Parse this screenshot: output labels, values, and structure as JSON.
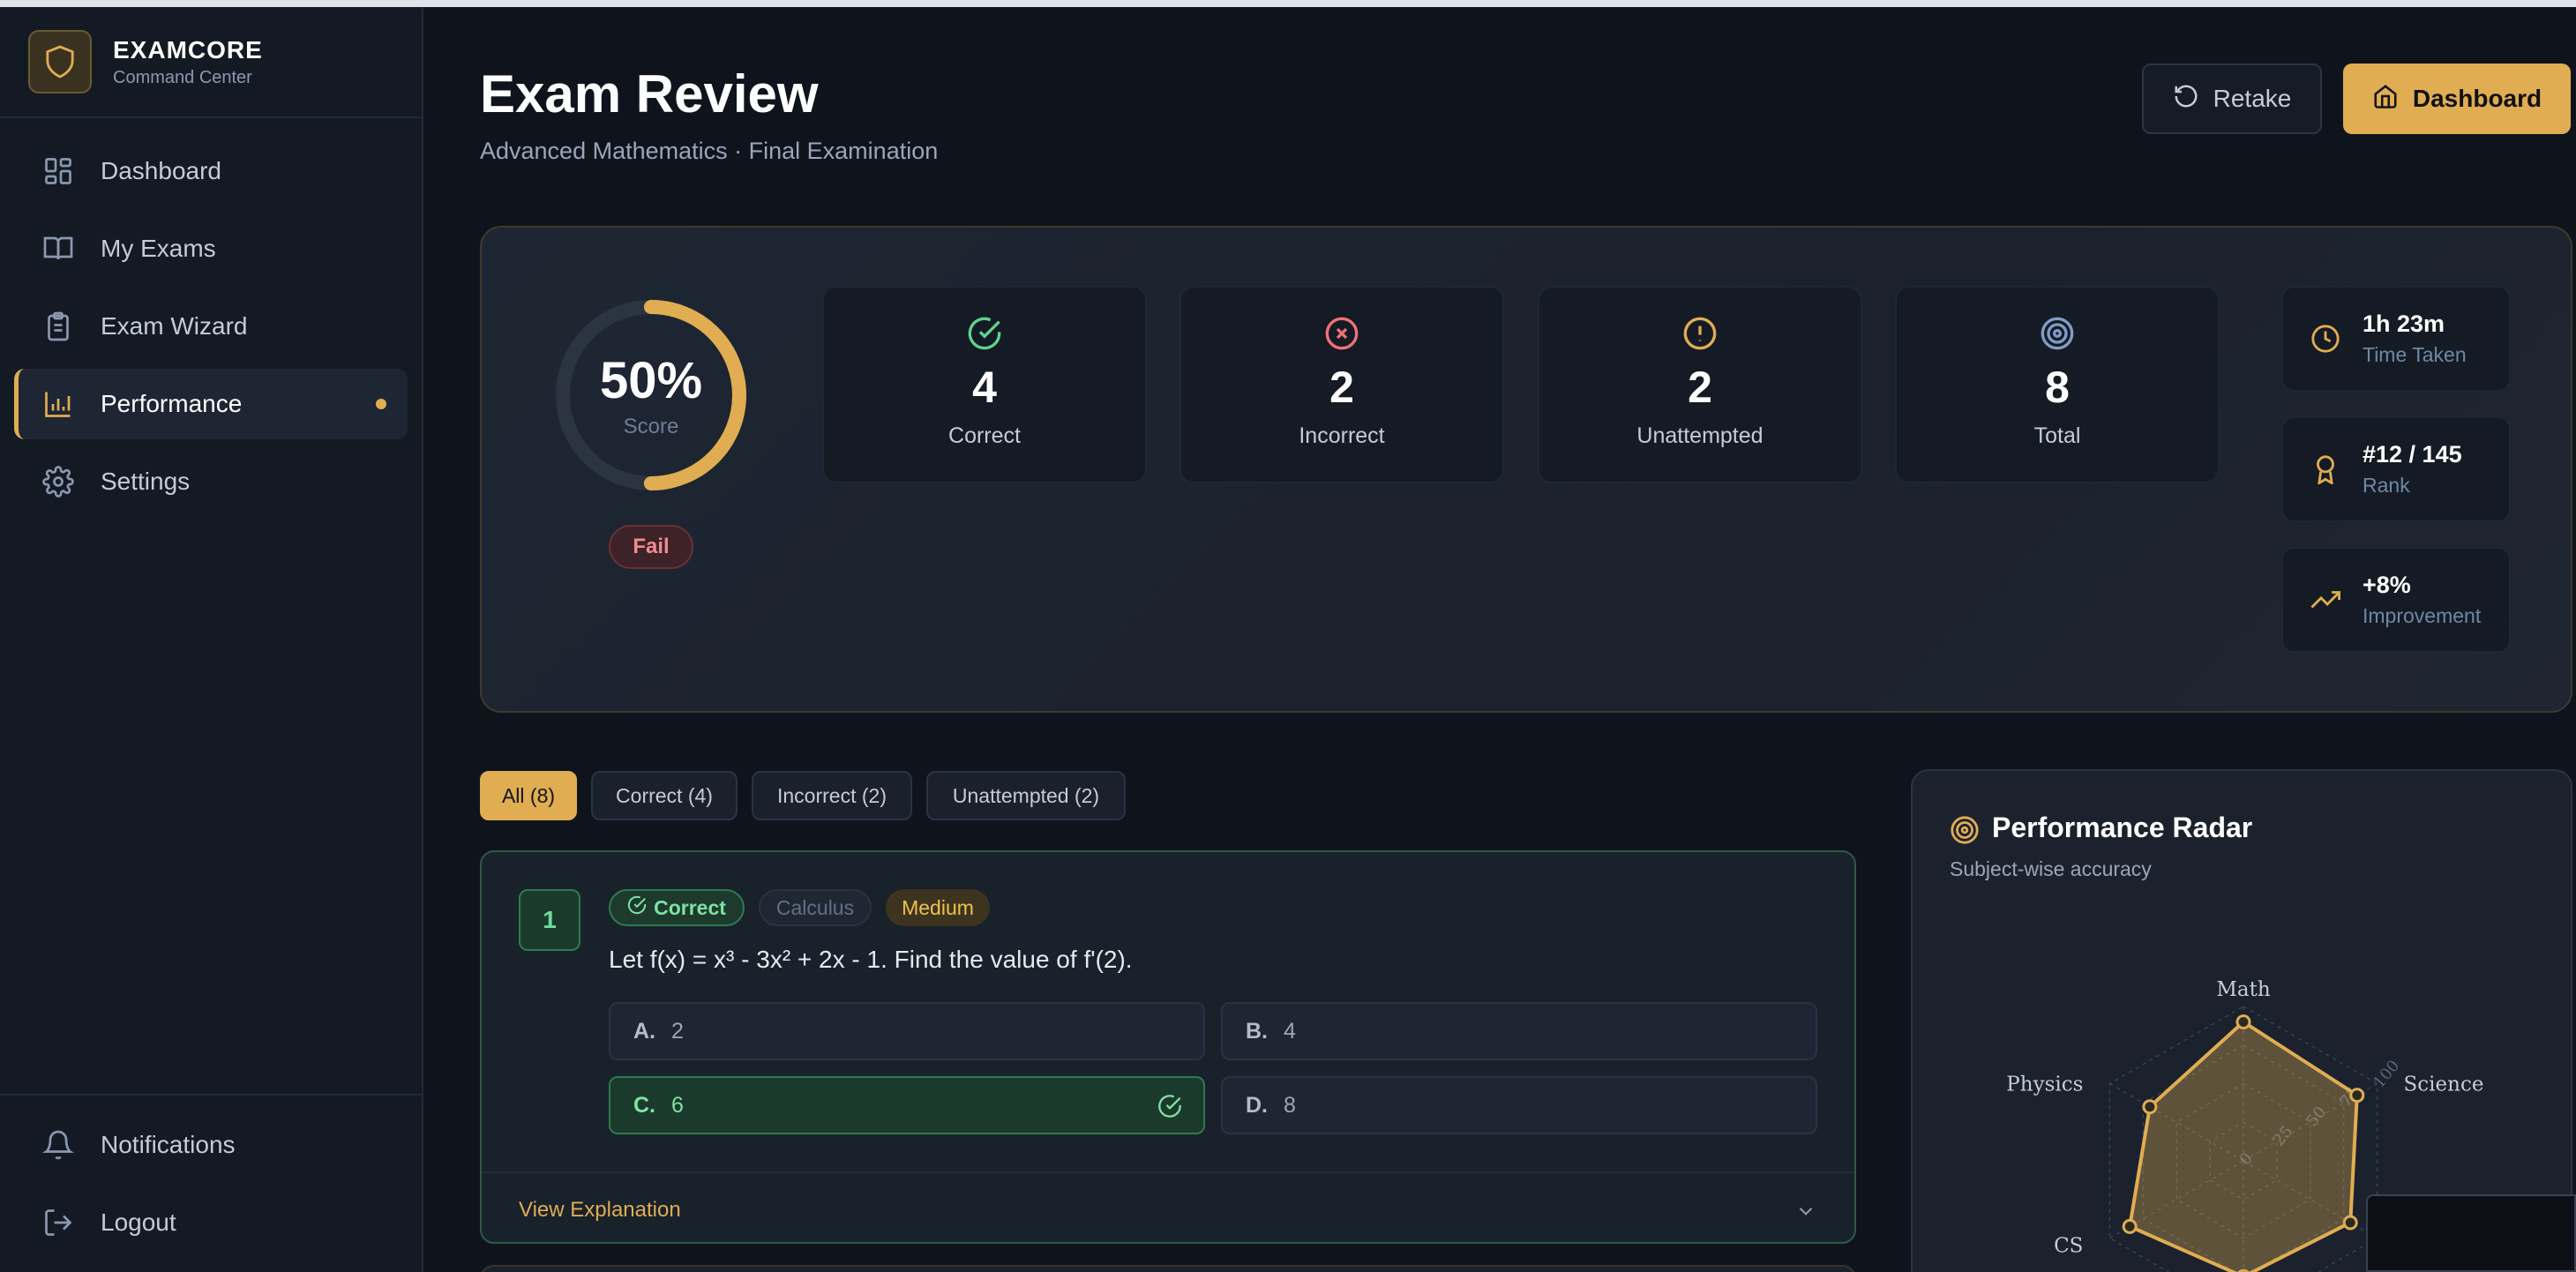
{
  "brand": {
    "name": "EXAMCORE",
    "subtitle": "Command Center"
  },
  "sidebar": {
    "items": [
      {
        "label": "Dashboard",
        "icon": "grid-icon",
        "active": false
      },
      {
        "label": "My Exams",
        "icon": "book-icon",
        "active": false
      },
      {
        "label": "Exam Wizard",
        "icon": "clipboard-icon",
        "active": false
      },
      {
        "label": "Performance",
        "icon": "bar-chart-icon",
        "active": true
      },
      {
        "label": "Settings",
        "icon": "gear-icon",
        "active": false
      }
    ],
    "bottom_items": [
      {
        "label": "Notifications",
        "icon": "bell-icon"
      },
      {
        "label": "Logout",
        "icon": "logout-icon"
      }
    ]
  },
  "header": {
    "title": "Exam Review",
    "subtitle": "Advanced Mathematics · Final Examination",
    "retake_label": "Retake",
    "dashboard_label": "Dashboard"
  },
  "summary": {
    "score": {
      "value": "50%",
      "label": "Score",
      "fraction": 0.5,
      "result": "Fail"
    },
    "stats": [
      {
        "value": "4",
        "label": "Correct",
        "icon": "check-circle-icon",
        "color": "#5fd38b"
      },
      {
        "value": "2",
        "label": "Incorrect",
        "icon": "x-circle-icon",
        "color": "#f07178"
      },
      {
        "value": "2",
        "label": "Unattempted",
        "icon": "alert-circle-icon",
        "color": "#e0ad52"
      },
      {
        "value": "8",
        "label": "Total",
        "icon": "target-icon",
        "color": "#7f9cc9"
      }
    ],
    "metrics": [
      {
        "value": "1h 23m",
        "label": "Time Taken",
        "icon": "clock-icon"
      },
      {
        "value": "#12 / 145",
        "label": "Rank",
        "icon": "award-icon"
      },
      {
        "value": "+8%",
        "label": "Improvement",
        "icon": "trending-up-icon"
      }
    ]
  },
  "filters": [
    "All (8)",
    "Correct (4)",
    "Incorrect (2)",
    "Unattempted (2)"
  ],
  "question": {
    "number": "1",
    "status": "Correct",
    "topic": "Calculus",
    "difficulty": "Medium",
    "text": "Let f(x) = x³ - 3x² + 2x - 1. Find the value of f'(2).",
    "options": [
      {
        "letter": "A.",
        "text": "2"
      },
      {
        "letter": "B.",
        "text": "4"
      },
      {
        "letter": "C.",
        "text": "6"
      },
      {
        "letter": "D.",
        "text": "8"
      }
    ],
    "correct_option": "C.",
    "explanation_label": "View Explanation"
  },
  "radar": {
    "title": "Performance Radar",
    "subtitle": "Subject-wise accuracy",
    "axes": [
      "Math",
      "Science",
      "",
      "",
      "CS",
      "Physics"
    ],
    "ticks": [
      "0",
      "25",
      "50",
      "75",
      "100"
    ],
    "values": [
      90,
      85,
      80,
      75,
      85,
      70
    ],
    "accent": "#e0ad52"
  }
}
